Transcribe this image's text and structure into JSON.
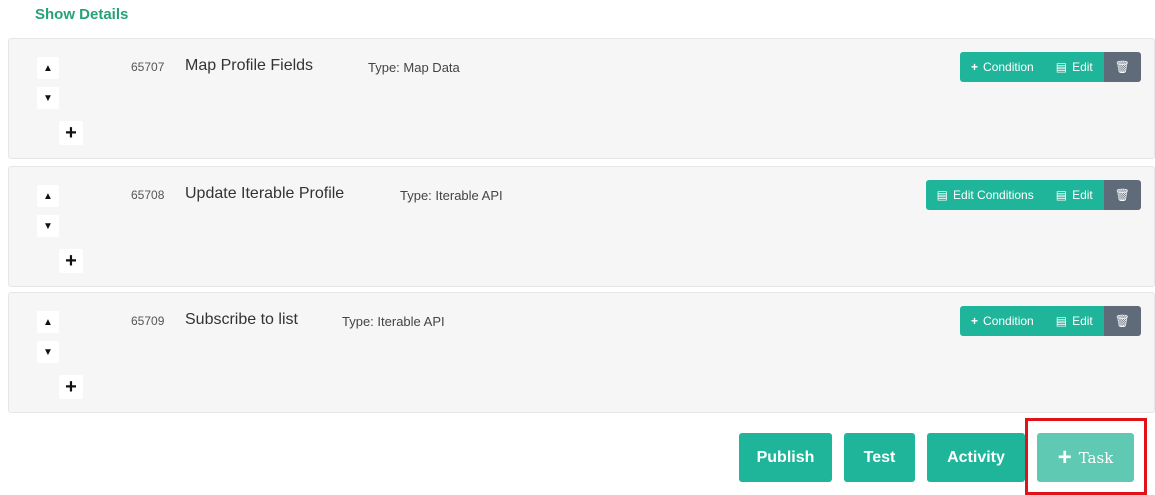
{
  "show_details": "Show Details",
  "tasks": [
    {
      "id": "65707",
      "name": "Map Profile Fields",
      "type": "Type: Map Data",
      "condition_label": "Condition",
      "edit_label": "Edit"
    },
    {
      "id": "65708",
      "name": "Update Iterable Profile",
      "type": "Type: Iterable API",
      "condition_label": "Edit Conditions",
      "edit_label": "Edit"
    },
    {
      "id": "65709",
      "name": "Subscribe to list",
      "type": "Type: Iterable API",
      "condition_label": "Condition",
      "edit_label": "Edit"
    }
  ],
  "icons": {
    "move_up": "▲",
    "move_down": "▼",
    "add": "+",
    "doc": "▤",
    "trash": "🗑"
  },
  "footer": {
    "publish": "Publish",
    "test": "Test",
    "activity": "Activity",
    "task": "Task"
  },
  "colors": {
    "accent": "#1fb59a",
    "accent_light": "#5fc9b3",
    "delete": "#5f6b78",
    "link": "#26a17a",
    "highlight": "#e0121a"
  }
}
